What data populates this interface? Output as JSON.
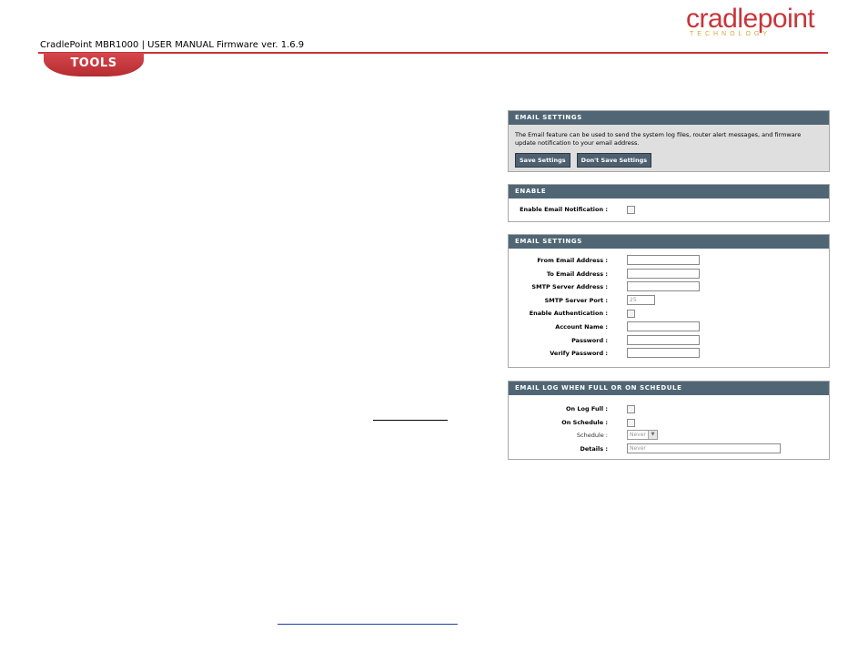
{
  "brand": {
    "logo_word": "cradlepoint",
    "logo_sub": "TECHNOLOGY",
    "accent": "#c8353a",
    "sub_color": "#d9a531"
  },
  "header": {
    "doc_title": "CradlePoint MBR1000 | USER MANUAL Firmware ver. 1.6.9",
    "section_tab": "TOOLS"
  },
  "panel_intro": {
    "title": "EMAIL SETTINGS",
    "description": "The Email feature can be used to send the system log files, router alert messages, and firmware update notification to your email address.",
    "save_label": "Save Settings",
    "dont_save_label": "Don't Save Settings"
  },
  "panel_enable": {
    "title": "ENABLE",
    "enable_label": "Enable Email Notification :"
  },
  "panel_email": {
    "title": "EMAIL SETTINGS",
    "from_label": "From Email Address :",
    "to_label": "To Email Address :",
    "smtp_label": "SMTP Server Address :",
    "port_label": "SMTP Server Port :",
    "port_value": "25",
    "auth_label": "Enable Authentication :",
    "account_label": "Account Name :",
    "password_label": "Password :",
    "verify_label": "Verify Password :"
  },
  "panel_log": {
    "title": "EMAIL LOG WHEN FULL OR ON SCHEDULE",
    "full_label": "On Log Full :",
    "schedule_cb_label": "On Schedule :",
    "schedule_label": "Schedule :",
    "schedule_value": "Never",
    "details_label": "Details :",
    "details_value": "Never"
  },
  "colors": {
    "panel_header": "#506675",
    "button": "#4e6070",
    "intro_bg": "#dfdfdf"
  }
}
